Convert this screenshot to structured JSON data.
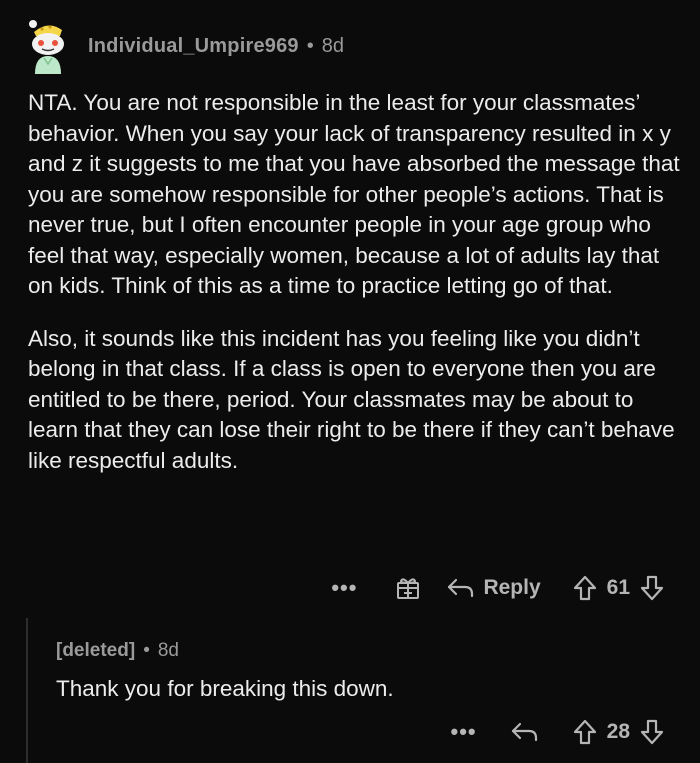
{
  "comment": {
    "username": "Individual_Umpire969",
    "age": "8d",
    "paragraphs": [
      "NTA. You are not responsible in the least for your classmates’ behavior.  When you say your lack of transparency resulted in x y and z it suggests to me that you have absorbed the message that you are somehow responsible for other people’s actions. That is never true, but I often encounter people in your age group who feel that way, especially women, because a lot of adults lay that on kids. Think of this as a time to practice letting go of that.",
      "Also, it sounds like this incident has you feeling like you didn’t belong in that class. If a class is open to everyone then you are entitled to be there, period. Your classmates may be about to learn that they can lose their right to be there if they can’t behave like respectful adults."
    ],
    "actions": {
      "more": "•••",
      "reply_label": "Reply",
      "score": "61"
    }
  },
  "reply": {
    "username": "[deleted]",
    "age": "8d",
    "text": "Thank you for breaking this down.",
    "actions": {
      "more": "•••",
      "score": "28"
    }
  },
  "separator": "•",
  "colors": {
    "background": "#0b0b0b",
    "text": "#ececec",
    "meta": "#9a9a9a"
  },
  "icons": {
    "avatar": "snoo-avatar-icon",
    "gift": "gift-icon",
    "reply": "reply-arrow-icon",
    "upvote": "upvote-arrow-icon",
    "downvote": "downvote-arrow-icon"
  }
}
